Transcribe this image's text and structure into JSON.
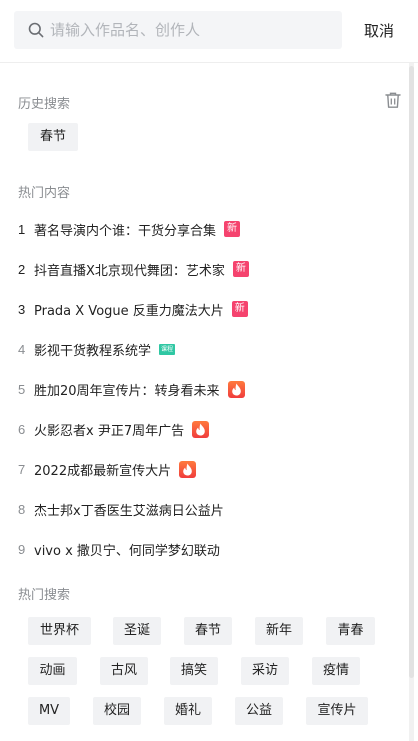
{
  "search": {
    "placeholder": "请输入作品名、创作人",
    "cancel_label": "取消"
  },
  "history": {
    "title": "历史搜索",
    "items": [
      "春节"
    ]
  },
  "hot_content": {
    "title": "热门内容",
    "items": [
      {
        "rank": "1",
        "title": "著名导演内个谁：干货分享合集",
        "badge": "new",
        "badge_text": "新"
      },
      {
        "rank": "2",
        "title": "抖音直播X北京现代舞团：艺术家",
        "badge": "new",
        "badge_text": "新"
      },
      {
        "rank": "3",
        "title": "Prada X Vogue 反重力魔法大片",
        "badge": "new",
        "badge_text": "新"
      },
      {
        "rank": "4",
        "title": "影视干货教程系统学",
        "badge": "course",
        "badge_text": "课程"
      },
      {
        "rank": "5",
        "title": "胜加20周年宣传片：转身看未来",
        "badge": "fire",
        "badge_text": ""
      },
      {
        "rank": "6",
        "title": "火影忍者x 尹正7周年广告",
        "badge": "fire",
        "badge_text": ""
      },
      {
        "rank": "7",
        "title": "2022成都最新宣传大片",
        "badge": "fire",
        "badge_text": ""
      },
      {
        "rank": "8",
        "title": "杰士邦x丁香医生艾滋病日公益片",
        "badge": "none",
        "badge_text": ""
      },
      {
        "rank": "9",
        "title": "vivo x 撒贝宁、何同学梦幻联动",
        "badge": "none",
        "badge_text": ""
      }
    ]
  },
  "hot_search": {
    "title": "热门搜索",
    "tags": [
      "世界杯",
      "圣诞",
      "春节",
      "新年",
      "青春",
      "动画",
      "古风",
      "搞笑",
      "采访",
      "疫情",
      "MV",
      "校园",
      "婚礼",
      "公益",
      "宣传片"
    ]
  },
  "colors": {
    "badge_new": "#f5436e",
    "badge_course": "#2fc7a3",
    "badge_fire": "#f03d3d",
    "muted_text": "#8a8d91",
    "chip_bg": "#f1f2f4"
  },
  "icons": {
    "search": "search-icon",
    "trash": "trash-icon",
    "fire": "fire-icon"
  }
}
